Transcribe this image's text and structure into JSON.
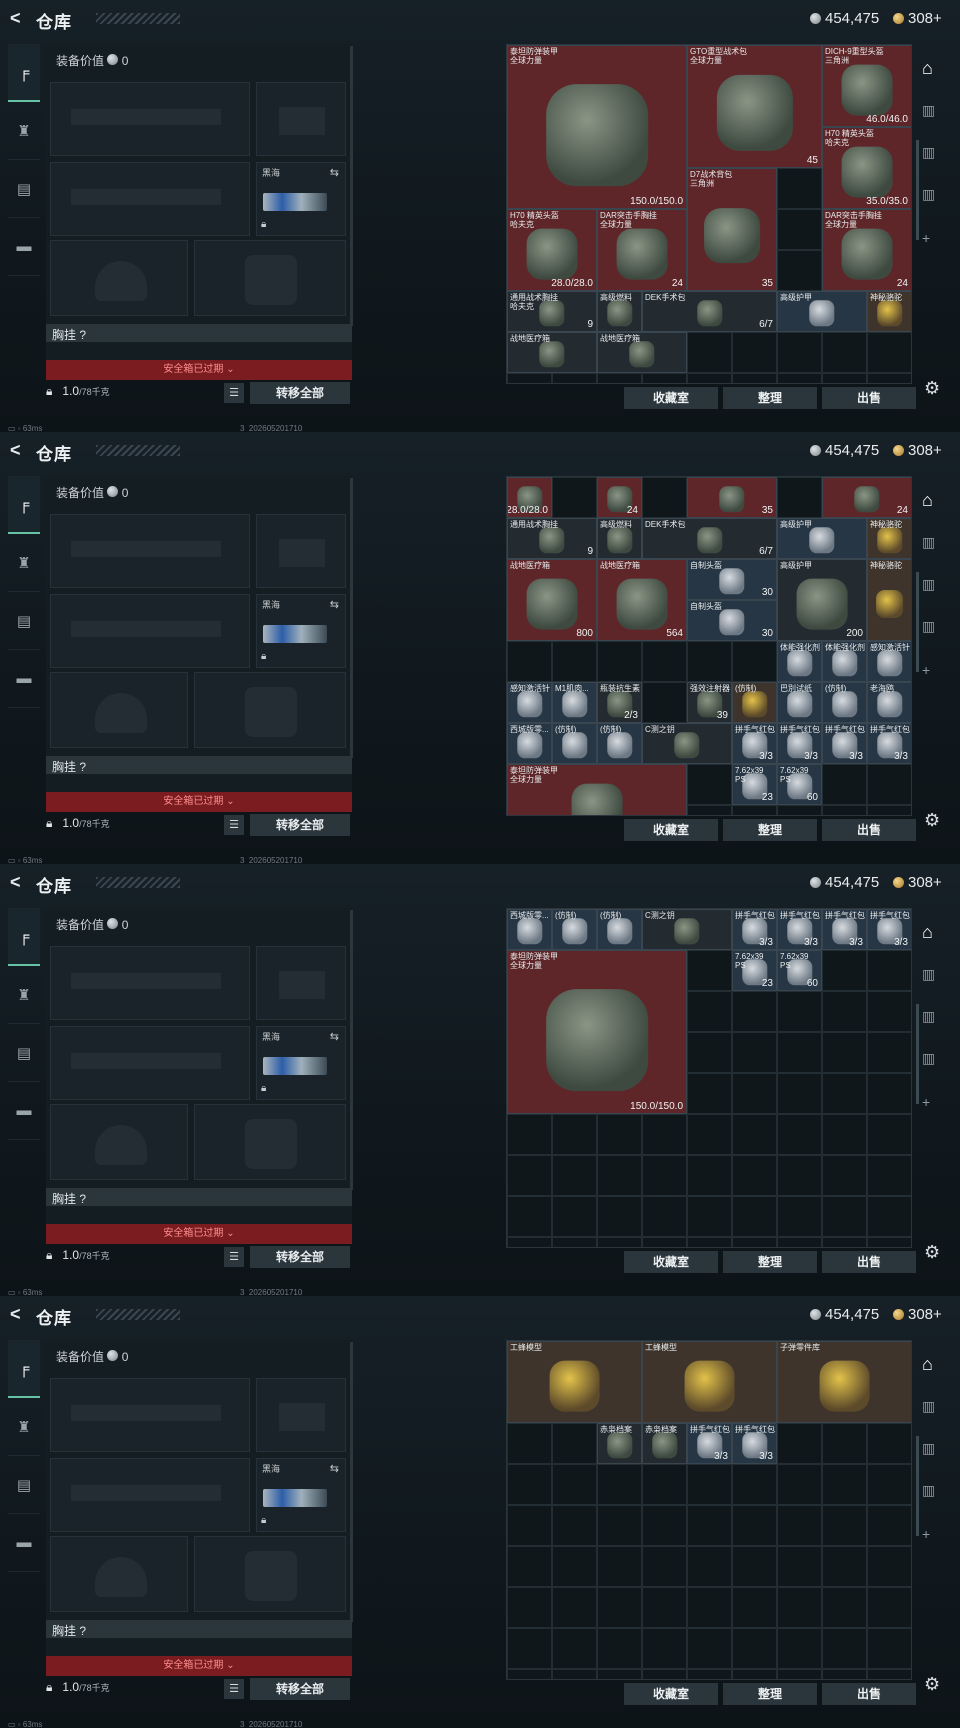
{
  "app": {
    "title": "仓库",
    "back": "<",
    "silver": "454,475",
    "gold": "308+",
    "status": "63ms",
    "build": "3_202605201710"
  },
  "equip": {
    "value_label": "装备价值",
    "value": "0",
    "melee_label": "黑海",
    "vest_label": "胸挂",
    "vest_q": "?",
    "safe_box": "安全箱已过期",
    "weight": "1.0",
    "weight_max": "/78千克",
    "transfer": "转移全部"
  },
  "tabs": [
    "firearm-icon",
    "armor-icon",
    "bag-icon",
    "case-icon"
  ],
  "buttons": {
    "collect": "收藏室",
    "sort": "整理",
    "sell": "出售"
  },
  "panels": [
    {
      "items": [
        {
          "name": "泰坦防弹装甲\n全球力量",
          "val": "150.0/150.0",
          "c": "red"
        },
        {
          "name": "GTO重型战术包\n全球力量",
          "val": "45",
          "c": "red"
        },
        {
          "name": "DICH-9重型头盔\n三角洲",
          "val": "46.0/46.0",
          "c": "red"
        },
        {
          "name": "H70 精英头盔\n哈夫克",
          "val": "35.0/35.0",
          "c": "red"
        },
        {
          "name": "D7战术背包\n三角洲",
          "val": "35",
          "c": "red"
        },
        {
          "name": "H70 精英头盔\n哈夫克",
          "val": "28.0/28.0",
          "c": "red"
        },
        {
          "name": "DAR突击手胸挂\n全球力量",
          "val": "24",
          "c": "red"
        },
        {
          "name": "DAR突击手胸挂\n全球力量",
          "val": "24",
          "c": "red"
        },
        {
          "name": "通用战术胸挂\n哈夫克",
          "val": "9",
          "c": "dark"
        },
        {
          "name": "高级燃料",
          "val": "",
          "c": "dark"
        },
        {
          "name": "DEK手术包",
          "val": "6/7",
          "c": "dark"
        },
        {
          "name": "高级护甲",
          "val": "",
          "c": "blue"
        },
        {
          "name": "神秘骆驼",
          "val": "",
          "c": "brown"
        },
        {
          "name": "战地医疗箱",
          "val": "",
          "c": "dark"
        },
        {
          "name": "战地医疗箱",
          "val": "",
          "c": "dark"
        }
      ]
    },
    {
      "items": [
        {
          "name": "",
          "val": "28.0/28.0",
          "c": "red"
        },
        {
          "name": "",
          "val": "24",
          "c": "red"
        },
        {
          "name": "",
          "val": "35",
          "c": "red"
        },
        {
          "name": "",
          "val": "24",
          "c": "red"
        },
        {
          "name": "通用战术胸挂",
          "val": "9",
          "c": "dark"
        },
        {
          "name": "高级燃料",
          "val": "",
          "c": "dark"
        },
        {
          "name": "DEK手术包",
          "val": "6/7",
          "c": "dark"
        },
        {
          "name": "高级护甲",
          "val": "",
          "c": "blue"
        },
        {
          "name": "神秘骆驼",
          "val": "",
          "c": "brown"
        },
        {
          "name": "战地医疗箱",
          "val": "800",
          "c": "red"
        },
        {
          "name": "战地医疗箱",
          "val": "564",
          "c": "red"
        },
        {
          "name": "自制头盔",
          "val": "30",
          "c": "blue"
        },
        {
          "name": "自制头盔",
          "val": "30",
          "c": "blue"
        },
        {
          "name": "高级护甲",
          "val": "200",
          "c": "dark"
        },
        {
          "name": "神秘骆驼",
          "val": "",
          "c": "brown"
        },
        {
          "name": "体能强化剂",
          "val": "",
          "c": "blue"
        },
        {
          "name": "体能强化剂",
          "val": "",
          "c": "blue"
        },
        {
          "name": "感知激活针",
          "val": "",
          "c": "blue"
        },
        {
          "name": "感知激活针",
          "val": "",
          "c": "blue"
        },
        {
          "name": "M1肌肉...",
          "val": "",
          "c": "blue"
        },
        {
          "name": "瓶装抗生素",
          "val": "2/3",
          "c": "dark"
        },
        {
          "name": "强效注射器",
          "val": "39",
          "c": "dark"
        },
        {
          "name": "(仿制)",
          "val": "",
          "c": "brown"
        },
        {
          "name": "巴別试纸",
          "val": "",
          "c": "blue"
        },
        {
          "name": "(仿制)",
          "val": "",
          "c": "blue"
        },
        {
          "name": "老海鸥",
          "val": "",
          "c": "blue"
        },
        {
          "name": "西城版零...",
          "val": "",
          "c": "blue"
        },
        {
          "name": "(仿制)",
          "val": "",
          "c": "blue"
        },
        {
          "name": "(仿制)",
          "val": "",
          "c": "blue"
        },
        {
          "name": "C测之钥",
          "val": "",
          "c": "dark"
        },
        {
          "name": "拼手气红包",
          "val": "3/3",
          "c": "blue"
        },
        {
          "name": "拼手气红包",
          "val": "3/3",
          "c": "blue"
        },
        {
          "name": "拼手气红包",
          "val": "3/3",
          "c": "blue"
        },
        {
          "name": "拼手气红包",
          "val": "3/3",
          "c": "blue"
        },
        {
          "name": "泰坦防弹装甲\n全球力量",
          "val": "",
          "c": "red"
        },
        {
          "name": "7.62x39\nPS",
          "val": "23",
          "c": "blue"
        },
        {
          "name": "7.62x39\nPS",
          "val": "60",
          "c": "blue"
        }
      ]
    },
    {
      "items": [
        {
          "name": "西城版零...",
          "val": "",
          "c": "blue"
        },
        {
          "name": "(仿制)",
          "val": "",
          "c": "blue"
        },
        {
          "name": "(仿制)",
          "val": "",
          "c": "blue"
        },
        {
          "name": "C测之钥",
          "val": "",
          "c": "dark"
        },
        {
          "name": "拼手气红包",
          "val": "3/3",
          "c": "blue"
        },
        {
          "name": "拼手气红包",
          "val": "3/3",
          "c": "blue"
        },
        {
          "name": "拼手气红包",
          "val": "3/3",
          "c": "blue"
        },
        {
          "name": "拼手气红包",
          "val": "3/3",
          "c": "blue"
        },
        {
          "name": "泰坦防弹装甲\n全球力量",
          "val": "150.0/150.0",
          "c": "red"
        },
        {
          "name": "7.62x39\nPS",
          "val": "23",
          "c": "blue"
        },
        {
          "name": "7.62x39\nPS",
          "val": "60",
          "c": "blue"
        }
      ]
    },
    {
      "items": [
        {
          "name": "工蜂模型",
          "val": "",
          "c": "brown"
        },
        {
          "name": "工蜂模型",
          "val": "",
          "c": "brown"
        },
        {
          "name": "子弹零件库",
          "val": "",
          "c": "brown"
        },
        {
          "name": "赤枭档案",
          "val": "",
          "c": "dark"
        },
        {
          "name": "赤枭档案",
          "val": "",
          "c": "dark"
        },
        {
          "name": "拼手气红包",
          "val": "3/3",
          "c": "blue"
        },
        {
          "name": "拼手气红包",
          "val": "3/3",
          "c": "blue"
        }
      ]
    }
  ]
}
